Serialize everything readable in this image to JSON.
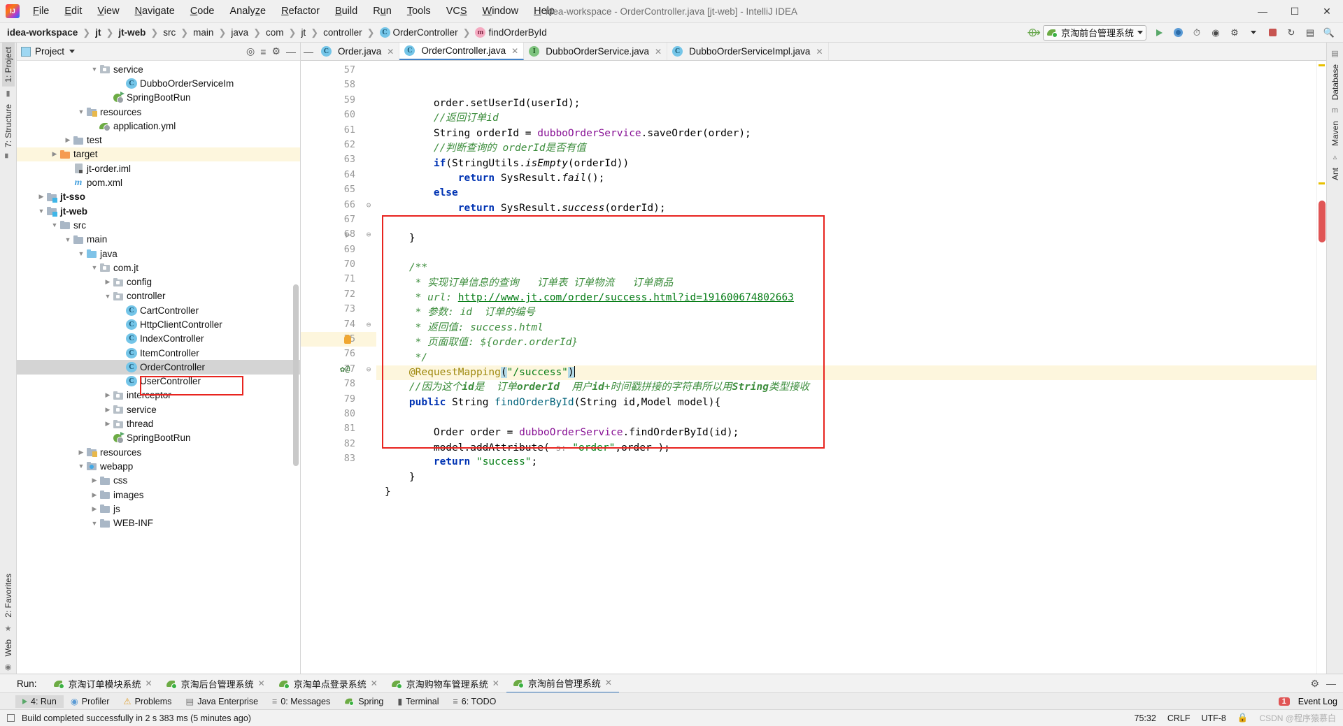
{
  "titlebar": {
    "window_title": "idea-workspace - OrderController.java [jt-web] - IntelliJ IDEA",
    "logo": "intellij-idea-logo",
    "menus": [
      "File",
      "Edit",
      "View",
      "Navigate",
      "Code",
      "Analyze",
      "Refactor",
      "Build",
      "Run",
      "Tools",
      "VCS",
      "Window",
      "Help"
    ],
    "window_buttons": {
      "minimize": "─",
      "maximize": "☐",
      "close": "✕"
    }
  },
  "navbar": {
    "breadcrumbs": [
      {
        "label": "idea-workspace",
        "bold": true,
        "icon": ""
      },
      {
        "label": "jt",
        "bold": true,
        "icon": ""
      },
      {
        "label": "jt-web",
        "bold": true,
        "icon": ""
      },
      {
        "label": "src",
        "bold": false,
        "icon": ""
      },
      {
        "label": "main",
        "bold": false,
        "icon": ""
      },
      {
        "label": "java",
        "bold": false,
        "icon": ""
      },
      {
        "label": "com",
        "bold": false,
        "icon": ""
      },
      {
        "label": "jt",
        "bold": false,
        "icon": ""
      },
      {
        "label": "controller",
        "bold": false,
        "icon": ""
      },
      {
        "label": "OrderController",
        "bold": false,
        "icon": "class-icon"
      },
      {
        "label": "findOrderById",
        "bold": false,
        "icon": "method-icon"
      }
    ],
    "separator": "❯",
    "run_config": {
      "name": "京淘前台管理系统",
      "icon": "spring-boot-leaf-icon"
    },
    "toolbar_icons": [
      "build-hammer-icon",
      "run-icon",
      "debug-icon",
      "run-with-coverage-icon",
      "profiler-icon",
      "attach-icon",
      "stop-icon",
      "update-project-icon",
      "settings-icon",
      "search-everywhere-icon"
    ]
  },
  "left_rail": {
    "top": [
      "1: Project",
      "7: Structure"
    ],
    "bottom": [
      "2: Favorites",
      "Web"
    ]
  },
  "right_rail": {
    "items": [
      "Database",
      "Maven",
      "Ant"
    ]
  },
  "project_panel": {
    "title": "Project",
    "header_icons": [
      "locate-icon",
      "collapse-all-icon",
      "gear-icon",
      "hide-icon"
    ],
    "tree": [
      {
        "indent": 6,
        "arrow": "down",
        "icon": "package-icon",
        "label": "service",
        "bold": false
      },
      {
        "indent": 8,
        "arrow": "none",
        "icon": "class-icon",
        "label": "DubboOrderServiceIm",
        "bold": false
      },
      {
        "indent": 7,
        "arrow": "none",
        "icon": "spring-icon",
        "label": "SpringBootRun",
        "bold": false
      },
      {
        "indent": 5,
        "arrow": "down",
        "icon": "resources-icon",
        "label": "resources",
        "bold": false
      },
      {
        "indent": 6,
        "arrow": "none",
        "icon": "yml-icon",
        "label": "application.yml",
        "bold": false
      },
      {
        "indent": 4,
        "arrow": "right",
        "icon": "folder-icon",
        "label": "test",
        "bold": false
      },
      {
        "indent": 3,
        "arrow": "right",
        "icon": "orange-folder-icon",
        "label": "target",
        "bold": false,
        "highlight": true
      },
      {
        "indent": 4,
        "arrow": "none",
        "icon": "iml-icon",
        "label": "jt-order.iml",
        "bold": false
      },
      {
        "indent": 4,
        "arrow": "none",
        "icon": "maven-icon",
        "label": "pom.xml",
        "bold": false
      },
      {
        "indent": 2,
        "arrow": "right",
        "icon": "module-icon",
        "label": "jt-sso",
        "bold": true
      },
      {
        "indent": 2,
        "arrow": "down",
        "icon": "module-icon",
        "label": "jt-web",
        "bold": true
      },
      {
        "indent": 3,
        "arrow": "down",
        "icon": "folder-icon",
        "label": "src",
        "bold": false
      },
      {
        "indent": 4,
        "arrow": "down",
        "icon": "folder-icon",
        "label": "main",
        "bold": false
      },
      {
        "indent": 5,
        "arrow": "down",
        "icon": "source-folder-icon",
        "label": "java",
        "bold": false
      },
      {
        "indent": 6,
        "arrow": "down",
        "icon": "package-icon",
        "label": "com.jt",
        "bold": false
      },
      {
        "indent": 7,
        "arrow": "right",
        "icon": "package-icon",
        "label": "config",
        "bold": false
      },
      {
        "indent": 7,
        "arrow": "down",
        "icon": "package-icon",
        "label": "controller",
        "bold": false
      },
      {
        "indent": 8,
        "arrow": "none",
        "icon": "class-icon",
        "label": "CartController",
        "bold": false
      },
      {
        "indent": 8,
        "arrow": "none",
        "icon": "class-icon",
        "label": "HttpClientController",
        "bold": false
      },
      {
        "indent": 8,
        "arrow": "none",
        "icon": "class-icon",
        "label": "IndexController",
        "bold": false
      },
      {
        "indent": 8,
        "arrow": "none",
        "icon": "class-icon",
        "label": "ItemController",
        "bold": false
      },
      {
        "indent": 8,
        "arrow": "none",
        "icon": "class-icon",
        "label": "OrderController",
        "bold": false,
        "selected": true
      },
      {
        "indent": 8,
        "arrow": "none",
        "icon": "class-icon",
        "label": "UserController",
        "bold": false
      },
      {
        "indent": 7,
        "arrow": "right",
        "icon": "package-icon",
        "label": "interceptor",
        "bold": false
      },
      {
        "indent": 7,
        "arrow": "right",
        "icon": "package-icon",
        "label": "service",
        "bold": false
      },
      {
        "indent": 7,
        "arrow": "right",
        "icon": "package-icon",
        "label": "thread",
        "bold": false
      },
      {
        "indent": 7,
        "arrow": "none",
        "icon": "spring-icon",
        "label": "SpringBootRun",
        "bold": false
      },
      {
        "indent": 5,
        "arrow": "right",
        "icon": "resources-icon",
        "label": "resources",
        "bold": false
      },
      {
        "indent": 5,
        "arrow": "down",
        "icon": "webapp-icon",
        "label": "webapp",
        "bold": false
      },
      {
        "indent": 6,
        "arrow": "right",
        "icon": "folder-icon",
        "label": "css",
        "bold": false
      },
      {
        "indent": 6,
        "arrow": "right",
        "icon": "folder-icon",
        "label": "images",
        "bold": false
      },
      {
        "indent": 6,
        "arrow": "right",
        "icon": "folder-icon",
        "label": "js",
        "bold": false
      },
      {
        "indent": 6,
        "arrow": "down",
        "icon": "folder-icon",
        "label": "WEB-INF",
        "bold": false
      }
    ]
  },
  "editor": {
    "tabs": [
      {
        "label": "Order.java",
        "icon": "class-icon",
        "active": false
      },
      {
        "label": "OrderController.java",
        "icon": "class-icon",
        "active": true
      },
      {
        "label": "DubboOrderService.java",
        "icon": "interface-icon",
        "active": false
      },
      {
        "label": "DubboOrderServiceImpl.java",
        "icon": "class-icon",
        "active": false
      }
    ],
    "first_line": 57,
    "lines": [
      {
        "n": 57,
        "html": "        order.setUserId(userId);"
      },
      {
        "n": 58,
        "html": "        <span class=\"cm\">//返回订单id</span>"
      },
      {
        "n": 59,
        "html": "        String orderId = <span class=\"fld\">dubboOrderService</span>.saveOrder(order);"
      },
      {
        "n": 60,
        "html": "        <span class=\"cm\">//判断查询的 orderId是否有值</span>"
      },
      {
        "n": 61,
        "html": "        <span class=\"k\">if</span>(StringUtils.<span class=\"sm\">isEmpty</span>(orderId))"
      },
      {
        "n": 62,
        "html": "            <span class=\"k\">return</span> SysResult.<span class=\"sm\">fail</span>();"
      },
      {
        "n": 63,
        "html": "        <span class=\"k\">else</span>"
      },
      {
        "n": 64,
        "html": "            <span class=\"k\">return</span> SysResult.<span class=\"sm\">success</span>(orderId);"
      },
      {
        "n": 65,
        "html": ""
      },
      {
        "n": 66,
        "html": "    }"
      },
      {
        "n": 67,
        "html": ""
      },
      {
        "n": 68,
        "html": "    <span class=\"cm\">/**</span>"
      },
      {
        "n": 69,
        "html": "     <span class=\"cm\">* 实现订单信息的查询   订单表 订单物流   订单商品</span>"
      },
      {
        "n": 70,
        "html": "     <span class=\"cm\">* url: </span><span class=\"lnk\">http://www.jt.com/order/success.html?id=191600674802663</span>"
      },
      {
        "n": 71,
        "html": "     <span class=\"cm\">* 参数: id  订单的编号</span>"
      },
      {
        "n": 72,
        "html": "     <span class=\"cm\">* 返回值: success.html</span>"
      },
      {
        "n": 73,
        "html": "     <span class=\"cm\">* 页面取值: ${order.orderId}</span>"
      },
      {
        "n": 74,
        "html": "     <span class=\"cm\">*/</span>"
      },
      {
        "n": 75,
        "html": "    <span class=\"an\">@RequestMapping</span><span class=\"brhl\">(</span><span class=\"s\">\"/success\"</span><span class=\"brhl\">)</span><span class=\"caret-bar\"></span>",
        "highlight": true
      },
      {
        "n": 76,
        "html": "    <span class=\"cm\">//因为这个<b>id</b>是  订单<b>orderId</b>  用户<b>id</b>+时间戳拼接的字符串所以用<b>String</b>类型接收</span>"
      },
      {
        "n": 77,
        "html": "    <span class=\"k\">public</span> String <span class=\"mth\">findOrderById</span>(String id,Model model){"
      },
      {
        "n": 78,
        "html": ""
      },
      {
        "n": 79,
        "html": "        Order order = <span class=\"fld\">dubboOrderService</span>.findOrderById(id);"
      },
      {
        "n": 80,
        "html": "        model.addAttribute( <span class=\"pkw\">s:</span> <span class=\"s\">\"order\"</span>,order );"
      },
      {
        "n": 81,
        "html": "        <span class=\"k\">return</span> <span class=\"s\">\"success\"</span>;"
      },
      {
        "n": 82,
        "html": "    }"
      },
      {
        "n": 83,
        "html": "}"
      }
    ],
    "highlight_box_label": "red-annotation-box"
  },
  "run_toolwindow": {
    "label": "Run:",
    "tabs": [
      {
        "label": "京淘订单模块系统",
        "icon": "spring-boot-leaf-icon",
        "active": false
      },
      {
        "label": "京淘后台管理系统",
        "icon": "spring-boot-leaf-icon",
        "active": false
      },
      {
        "label": "京淘单点登录系统",
        "icon": "spring-boot-leaf-icon",
        "active": false
      },
      {
        "label": "京淘购物车管理系统",
        "icon": "spring-boot-leaf-icon",
        "active": false
      },
      {
        "label": "京淘前台管理系统",
        "icon": "spring-boot-leaf-icon",
        "active": true
      }
    ],
    "right_icons": [
      "gear-icon",
      "hide-icon"
    ]
  },
  "bottom_strip": {
    "items": [
      {
        "label": "4: Run",
        "icon": "run-icon",
        "active": true
      },
      {
        "label": "Profiler",
        "icon": "profiler-icon",
        "active": false
      },
      {
        "label": "Problems",
        "icon": "problems-icon",
        "active": false
      },
      {
        "label": "Java Enterprise",
        "icon": "java-enterprise-icon",
        "active": false
      },
      {
        "label": "0: Messages",
        "icon": "messages-icon",
        "active": false
      },
      {
        "label": "Spring",
        "icon": "spring-icon",
        "active": false
      },
      {
        "label": "Terminal",
        "icon": "terminal-icon",
        "active": false
      },
      {
        "label": "6: TODO",
        "icon": "todo-icon",
        "active": false
      }
    ],
    "event_log": {
      "label": "Event Log",
      "badge": "1"
    }
  },
  "statusbar": {
    "message": "Build completed successfully in 2 s 383 ms (5 minutes ago)",
    "caret_position": "75:32",
    "line_separator": "CRLF",
    "encoding": "UTF-8",
    "watermark": "CSDN @程序猿慕白",
    "lock_icon": "lock-icon"
  },
  "colors": {
    "accent_blue": "#4282c8",
    "highlight_red": "#e8241f",
    "comment_green": "#3c8d3c",
    "string_green": "#067d17",
    "keyword_blue": "#0033b3",
    "field_purple": "#871094",
    "annotation_gold": "#9e880d",
    "selection_gray": "#d4d4d4",
    "current_line": "#fdf6dd"
  }
}
